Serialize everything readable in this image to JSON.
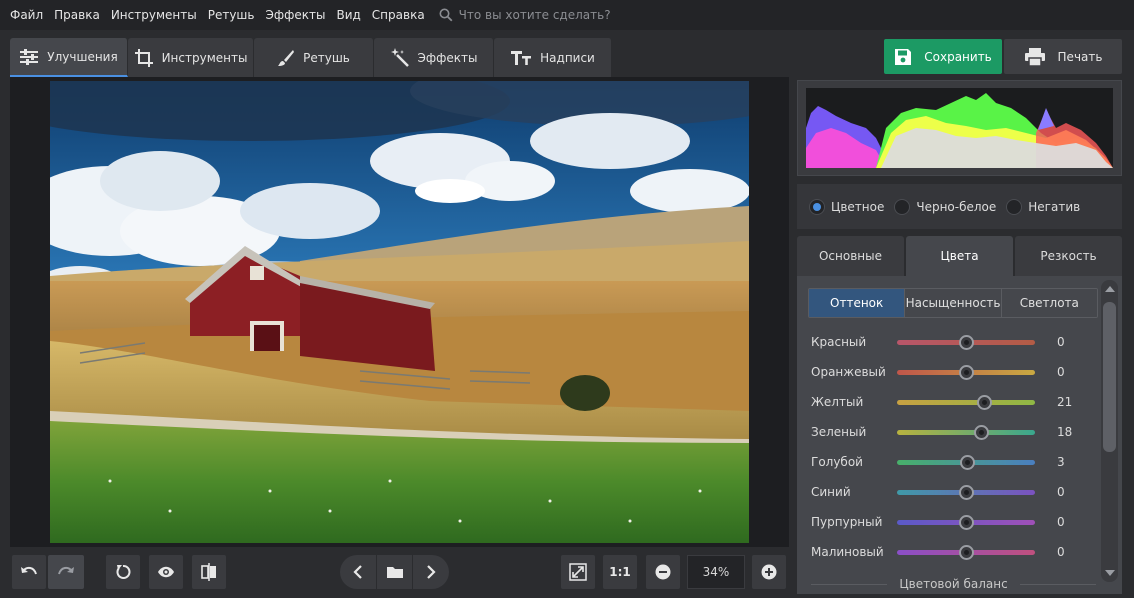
{
  "menubar": {
    "items": [
      "Файл",
      "Правка",
      "Инструменты",
      "Ретушь",
      "Эффекты",
      "Вид",
      "Справка"
    ],
    "search_placeholder": "Что вы хотите сделать?"
  },
  "tabs": [
    {
      "label": "Улучшения",
      "icon": "sliders-icon",
      "active": true
    },
    {
      "label": "Инструменты",
      "icon": "crop-icon",
      "active": false
    },
    {
      "label": "Ретушь",
      "icon": "brush-icon",
      "active": false
    },
    {
      "label": "Эффекты",
      "icon": "magic-wand-icon",
      "active": false
    },
    {
      "label": "Надписи",
      "icon": "text-icon",
      "active": false
    }
  ],
  "actions": {
    "save_label": "Сохранить",
    "print_label": "Печать"
  },
  "modes": [
    {
      "label": "Цветное",
      "selected": true
    },
    {
      "label": "Черно-белое",
      "selected": false
    },
    {
      "label": "Негатив",
      "selected": false
    }
  ],
  "subtabs": [
    {
      "label": "Основные",
      "active": false
    },
    {
      "label": "Цвета",
      "active": true
    },
    {
      "label": "Резкость",
      "active": false
    }
  ],
  "segtabs": [
    {
      "label": "Оттенок",
      "active": true
    },
    {
      "label": "Насыщенность",
      "active": false
    },
    {
      "label": "Светлота",
      "active": false
    }
  ],
  "sliders": [
    {
      "label": "Красный",
      "value": "0",
      "pos": 0.5,
      "colors": [
        "#b8566a",
        "#b35c45"
      ]
    },
    {
      "label": "Оранжевый",
      "value": "0",
      "pos": 0.5,
      "colors": [
        "#c0564a",
        "#c9a942"
      ]
    },
    {
      "label": "Желтый",
      "value": "21",
      "pos": 0.63,
      "colors": [
        "#c8a142",
        "#8fb845"
      ]
    },
    {
      "label": "Зеленый",
      "value": "18",
      "pos": 0.61,
      "colors": [
        "#b8b23f",
        "#3aa78e"
      ]
    },
    {
      "label": "Голубой",
      "value": "3",
      "pos": 0.51,
      "colors": [
        "#48b06a",
        "#4a7fc0"
      ]
    },
    {
      "label": "Синий",
      "value": "0",
      "pos": 0.5,
      "colors": [
        "#3f9aa8",
        "#7b52c0"
      ]
    },
    {
      "label": "Пурпурный",
      "value": "0",
      "pos": 0.5,
      "colors": [
        "#5a5ac8",
        "#a050b8"
      ]
    },
    {
      "label": "Малиновый",
      "value": "0",
      "pos": 0.5,
      "colors": [
        "#8a4fc8",
        "#c0507e"
      ]
    }
  ],
  "section_title": "Цветовой баланс",
  "zoom": {
    "one_to_one": "1:1",
    "value": "34%"
  },
  "colors": {
    "accent": "#4a90e2",
    "save": "#1c9a64"
  }
}
